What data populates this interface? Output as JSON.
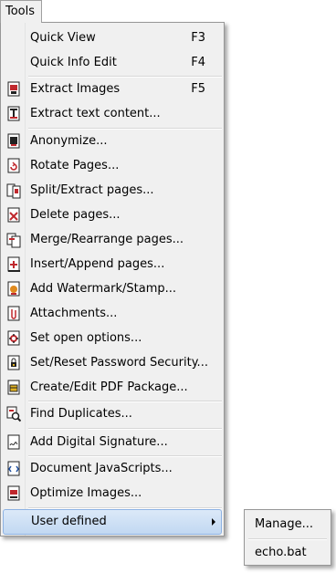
{
  "menubar": {
    "title": "Tools"
  },
  "menu": {
    "items": [
      {
        "label": "Quick View",
        "shortcut": "F3",
        "icon": ""
      },
      {
        "label": "Quick Info Edit",
        "shortcut": "F4",
        "icon": ""
      },
      {
        "label": "Extract Images",
        "shortcut": "F5",
        "icon": "extract-images-icon"
      },
      {
        "label": "Extract text content...",
        "shortcut": "",
        "icon": "extract-text-icon"
      },
      {
        "label": "Anonymize...",
        "shortcut": "",
        "icon": "anonymize-icon"
      },
      {
        "label": "Rotate Pages...",
        "shortcut": "",
        "icon": "rotate-pages-icon"
      },
      {
        "label": "Split/Extract pages...",
        "shortcut": "",
        "icon": "split-pages-icon"
      },
      {
        "label": "Delete pages...",
        "shortcut": "",
        "icon": "delete-pages-icon"
      },
      {
        "label": "Merge/Rearrange pages...",
        "shortcut": "",
        "icon": "merge-pages-icon"
      },
      {
        "label": "Insert/Append pages...",
        "shortcut": "",
        "icon": "insert-pages-icon"
      },
      {
        "label": "Add Watermark/Stamp...",
        "shortcut": "",
        "icon": "watermark-icon"
      },
      {
        "label": "Attachments...",
        "shortcut": "",
        "icon": "attachments-icon"
      },
      {
        "label": "Set open options...",
        "shortcut": "",
        "icon": "open-options-icon"
      },
      {
        "label": "Set/Reset Password Security...",
        "shortcut": "",
        "icon": "password-security-icon"
      },
      {
        "label": "Create/Edit PDF Package...",
        "shortcut": "",
        "icon": "pdf-package-icon"
      },
      {
        "label": "Find Duplicates...",
        "shortcut": "",
        "icon": "find-duplicates-icon"
      },
      {
        "label": "Add Digital Signature...",
        "shortcut": "",
        "icon": "digital-signature-icon"
      },
      {
        "label": "Document JavaScripts...",
        "shortcut": "",
        "icon": "javascripts-icon"
      },
      {
        "label": "Optimize Images...",
        "shortcut": "",
        "icon": "optimize-images-icon"
      },
      {
        "label": "User defined",
        "shortcut": "",
        "icon": ""
      }
    ]
  },
  "submenu": {
    "items": [
      {
        "label": "Manage..."
      },
      {
        "label": "echo.bat"
      }
    ]
  },
  "colors": {
    "menu_bg": "#f0f0f0",
    "highlight_bg": "#c2d8f2",
    "highlight_border": "#8db2e3",
    "icon_red": "#c0282d",
    "icon_dark": "#1a1a1a"
  }
}
